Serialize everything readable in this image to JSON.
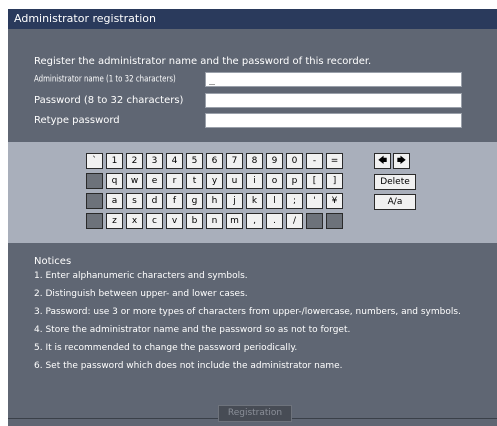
{
  "dialog": {
    "title": "Administrator registration",
    "intro": "Register the administrator name and the password of this recorder.",
    "fields": [
      {
        "label": "Administrator name (1 to 32 characters)",
        "value": "_"
      },
      {
        "label": "Password (8 to 32 characters)",
        "value": ""
      },
      {
        "label": "Retype password",
        "value": ""
      }
    ],
    "keyboard": {
      "row1": [
        "`",
        "1",
        "2",
        "3",
        "4",
        "5",
        "6",
        "7",
        "8",
        "9",
        "0",
        "-",
        "="
      ],
      "row2": [
        "",
        "q",
        "w",
        "e",
        "r",
        "t",
        "y",
        "u",
        "i",
        "o",
        "p",
        "[",
        "]"
      ],
      "row3": [
        "",
        "a",
        "s",
        "d",
        "f",
        "g",
        "h",
        "j",
        "k",
        "l",
        ";",
        "'",
        "¥"
      ],
      "row4": [
        "",
        "z",
        "x",
        "c",
        "v",
        "b",
        "n",
        "m",
        ",",
        ".",
        "/",
        "",
        ""
      ],
      "arrow_left": "🡄",
      "arrow_right": "🡆",
      "delete_label": "Delete",
      "case_label": "A/a"
    },
    "notices_title": "Notices",
    "notices": [
      "1. Enter alphanumeric characters and symbols.",
      "2. Distinguish between upper- and lower cases.",
      "3. Password: use 3 or more types of characters from upper-/lowercase, numbers, and symbols.",
      "4. Store the administrator name and the password so as not to forget.",
      "5. It is recommended to change the password periodically.",
      "6. Set the password which does not include the administrator name."
    ],
    "register_label": "Registration"
  }
}
